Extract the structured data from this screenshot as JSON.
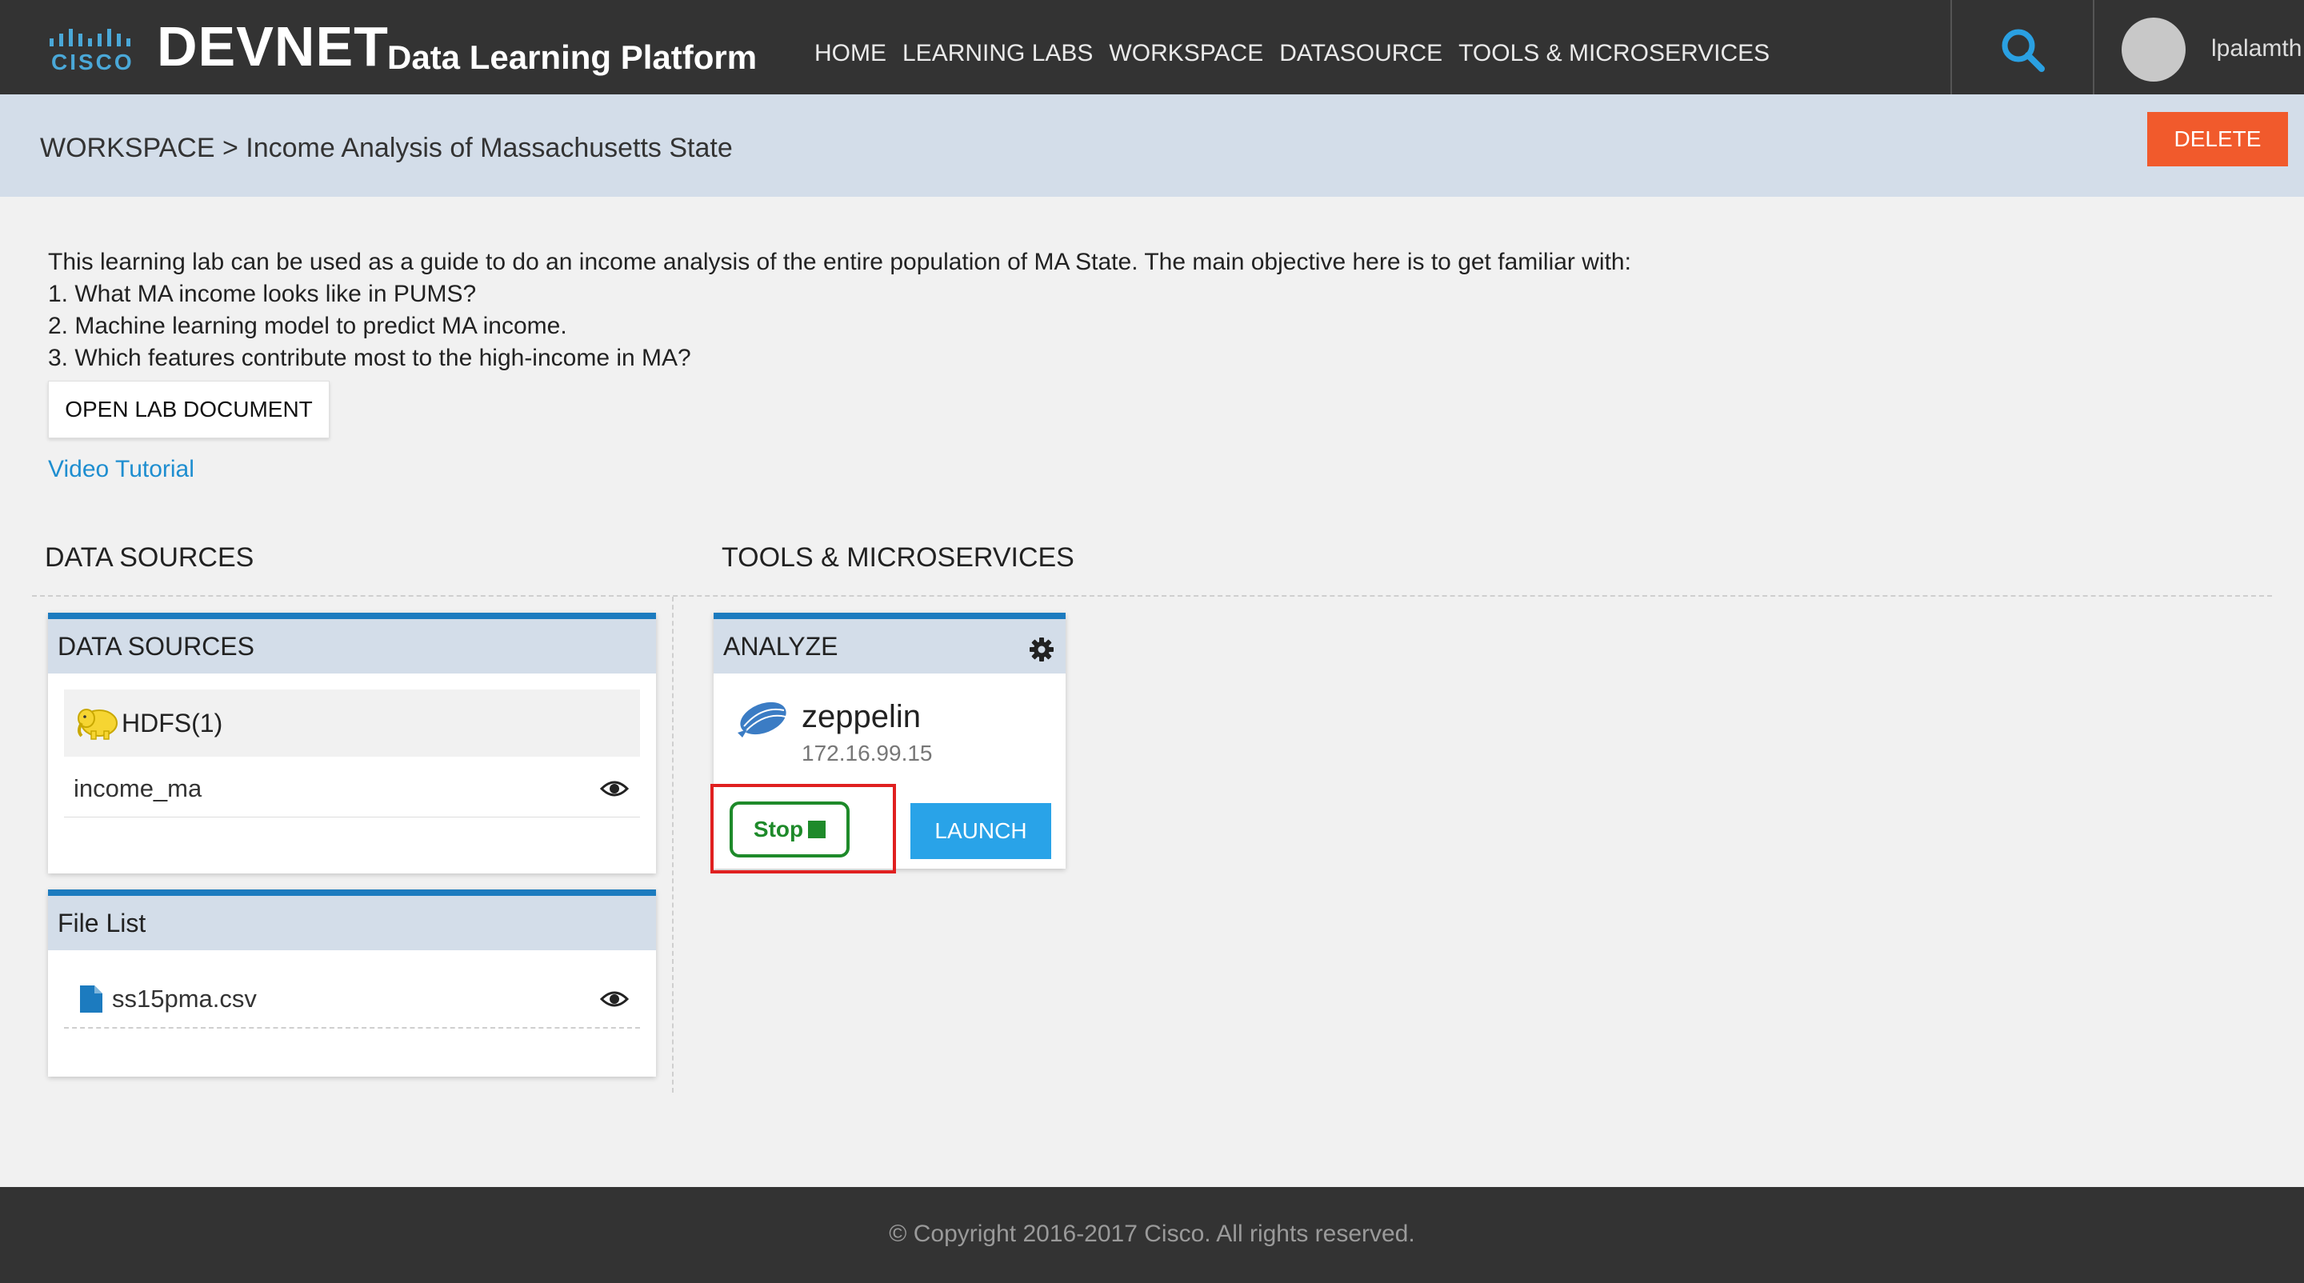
{
  "header": {
    "logo_text": "CISCO",
    "brand": "DEVNET",
    "product": "Data Learning Platform",
    "nav": [
      "HOME",
      "LEARNING LABS",
      "WORKSPACE",
      "DATASOURCE",
      "TOOLS & MICROSERVICES"
    ],
    "username": "lpalamth"
  },
  "breadcrumb": {
    "text": "WORKSPACE > Income Analysis of Massachusetts State",
    "delete_label": "DELETE"
  },
  "description": {
    "lines": [
      "This learning lab can be used as a guide to do an income analysis of the entire population of MA State. The main objective here is to get familiar with:",
      "1. What MA income looks like in PUMS?",
      "2. Machine learning model to predict MA income.",
      "3. Which features contribute most to the high-income in MA?"
    ],
    "open_lab_label": "OPEN LAB DOCUMENT",
    "video_link": "Video Tutorial"
  },
  "sections": {
    "data_sources_title": "DATA SOURCES",
    "tools_title": "TOOLS & MICROSERVICES"
  },
  "data_sources_card": {
    "header": "DATA SOURCES",
    "group": "HDFS(1)",
    "item": "income_ma"
  },
  "file_list_card": {
    "header": "File List",
    "file": "ss15pma.csv"
  },
  "analyze_card": {
    "header": "ANALYZE",
    "tool_name": "zeppelin",
    "ip": "172.16.99.15",
    "stop_label": "Stop",
    "launch_label": "LAUNCH"
  },
  "footer": {
    "copyright": "© Copyright 2016-2017 Cisco. All rights reserved."
  },
  "colors": {
    "topbar": "#333333",
    "accent_blue": "#1c7bbf",
    "delete_red": "#f15a2c",
    "launch_blue": "#29a3e8",
    "stop_green": "#1e8a2a",
    "highlight_red": "#e02020"
  }
}
